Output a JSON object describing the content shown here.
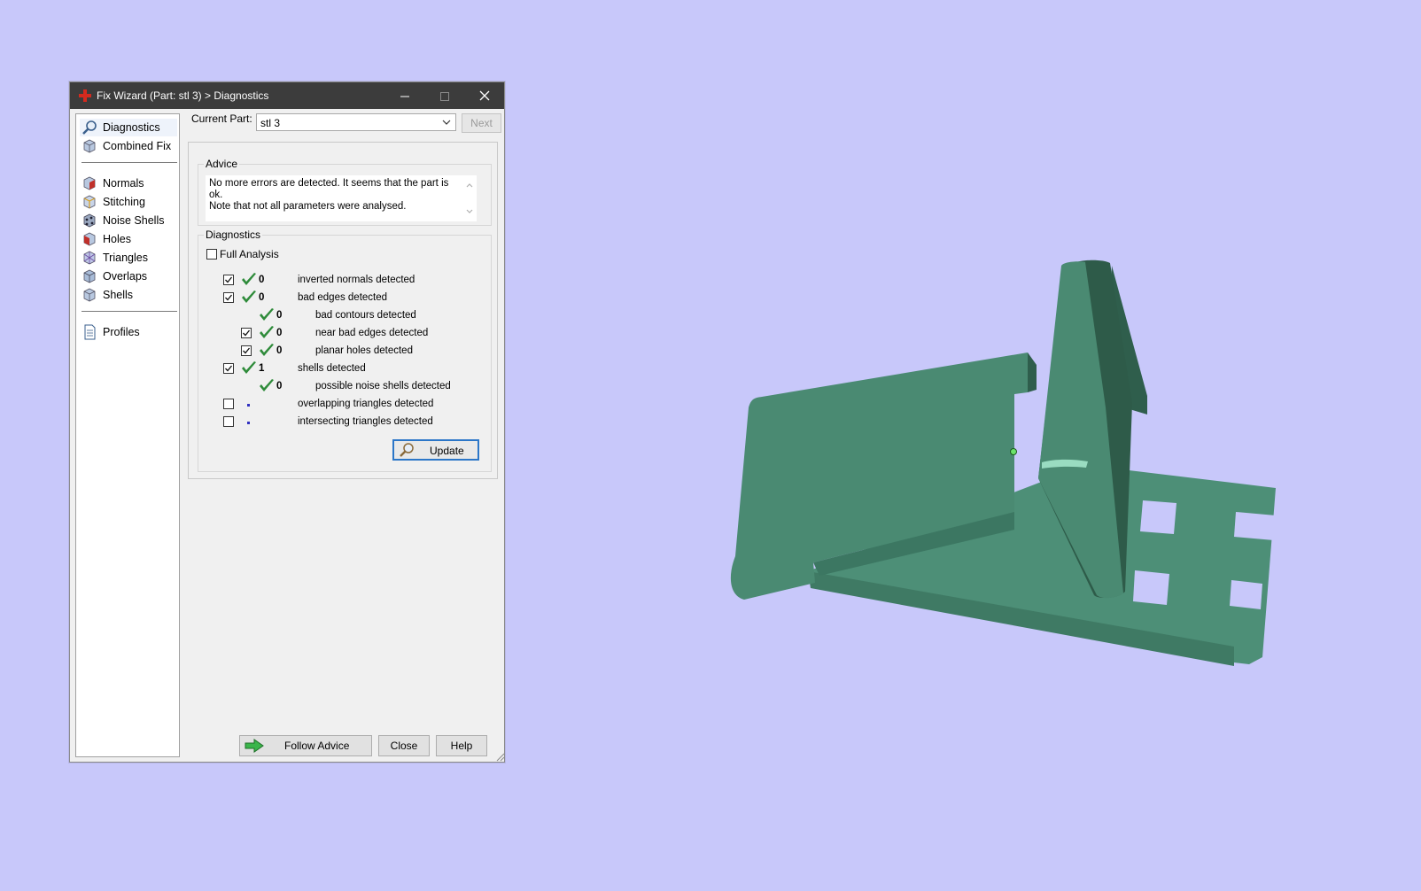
{
  "dialog": {
    "title": "Fix Wizard (Part: stl 3) > Diagnostics",
    "icons": {
      "app": "red-cross-icon",
      "minimize": "minimize-icon",
      "maximize": "maximize-icon",
      "close": "close-icon"
    }
  },
  "nav": {
    "items": [
      {
        "label": "Diagnostics",
        "icon": "magnifier-icon",
        "selected": true
      },
      {
        "label": "Combined Fix",
        "icon": "cube-icon"
      },
      {
        "label": "Normals",
        "icon": "normals-icon"
      },
      {
        "label": "Stitching",
        "icon": "stitching-icon"
      },
      {
        "label": "Noise Shells",
        "icon": "noise-shells-icon"
      },
      {
        "label": "Holes",
        "icon": "holes-icon"
      },
      {
        "label": "Triangles",
        "icon": "triangles-icon"
      },
      {
        "label": "Overlaps",
        "icon": "overlaps-icon"
      },
      {
        "label": "Shells",
        "icon": "shells-icon"
      },
      {
        "label": "Profiles",
        "icon": "document-icon"
      }
    ]
  },
  "current_part": {
    "label": "Current Part:",
    "value": "stl 3",
    "next_label": "Next"
  },
  "advice": {
    "title": "Advice",
    "line1": "No more errors are detected. It seems that the part is ok.",
    "line2": "Note that not all parameters were analysed."
  },
  "diagnostics": {
    "title": "Diagnostics",
    "full_analysis_label": "Full Analysis",
    "full_analysis_checked": false,
    "rows": [
      {
        "checkbox": true,
        "checked": true,
        "status": "ok",
        "count": "0",
        "label": "inverted normals detected",
        "indent": 0
      },
      {
        "checkbox": true,
        "checked": true,
        "status": "ok",
        "count": "0",
        "label": "bad edges detected",
        "indent": 0
      },
      {
        "checkbox": false,
        "checked": false,
        "status": "ok",
        "count": "0",
        "label": "bad contours detected",
        "indent": 1
      },
      {
        "checkbox": true,
        "checked": true,
        "status": "ok",
        "count": "0",
        "label": "near bad edges detected",
        "indent": 1
      },
      {
        "checkbox": true,
        "checked": true,
        "status": "ok",
        "count": "0",
        "label": "planar holes detected",
        "indent": 1
      },
      {
        "checkbox": true,
        "checked": true,
        "status": "ok",
        "count": "1",
        "label": "shells detected",
        "indent": 0
      },
      {
        "checkbox": false,
        "checked": false,
        "status": "ok",
        "count": "0",
        "label": "possible noise shells detected",
        "indent": 1
      },
      {
        "checkbox": true,
        "checked": false,
        "status": "pending",
        "count": "",
        "label": "overlapping triangles detected",
        "indent": 0
      },
      {
        "checkbox": true,
        "checked": false,
        "status": "pending",
        "count": "",
        "label": "intersecting triangles detected",
        "indent": 0
      }
    ],
    "update_label": "Update"
  },
  "buttons": {
    "follow_advice": "Follow Advice",
    "close": "Close",
    "help": "Help"
  },
  "colors": {
    "background": "#c8c8fa",
    "titlebar": "#3c3c3c",
    "part_fill": "#4a8a72",
    "part_shadow": "#2f5e4c",
    "check_green": "#2e8b3a",
    "focus_blue": "#2b76c8"
  }
}
